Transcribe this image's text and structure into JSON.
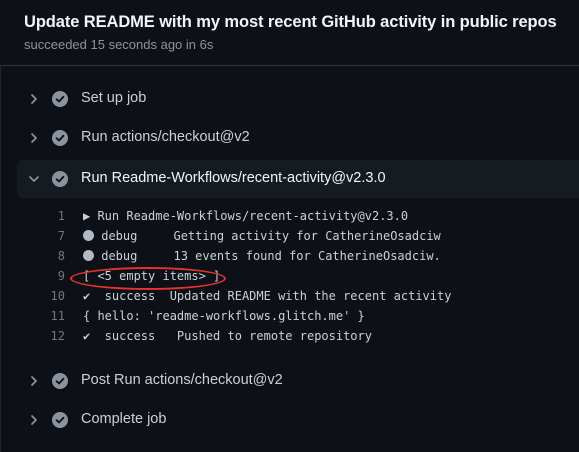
{
  "header": {
    "title": "Update README with my most recent GitHub activity in public repos",
    "status": "succeeded 15 seconds ago in 6s"
  },
  "colors": {
    "background": "#0d1117",
    "success_icon": "#8b949e",
    "annotation": "#e5322d"
  },
  "steps": [
    {
      "label": "Set up job",
      "expanded": false,
      "icon": "check-circle-icon"
    },
    {
      "label": "Run actions/checkout@v2",
      "expanded": false,
      "icon": "check-circle-icon"
    },
    {
      "label": "Run Readme-Workflows/recent-activity@v2.3.0",
      "expanded": true,
      "icon": "check-circle-icon"
    },
    {
      "label": "Post Run actions/checkout@v2",
      "expanded": false,
      "icon": "check-circle-icon"
    },
    {
      "label": "Complete job",
      "expanded": false,
      "icon": "check-circle-icon"
    }
  ],
  "log": [
    {
      "num": "1",
      "text": "▶ Run Readme-Workflows/recent-activity@v2.3.0",
      "marker": ""
    },
    {
      "num": "7",
      "text": " debug     Getting activity for CatherineOsadciw",
      "marker": "dot"
    },
    {
      "num": "8",
      "text": " debug     13 events found for CatherineOsadciw.",
      "marker": "dot"
    },
    {
      "num": "9",
      "text": "[ <5 empty items> ]",
      "marker": ""
    },
    {
      "num": "10",
      "text": "✔  success  Updated README with the recent activity",
      "marker": ""
    },
    {
      "num": "11",
      "text": "{ hello: 'readme-workflows.glitch.me' }",
      "marker": ""
    },
    {
      "num": "12",
      "text": "✔  success   Pushed to remote repository",
      "marker": ""
    }
  ]
}
